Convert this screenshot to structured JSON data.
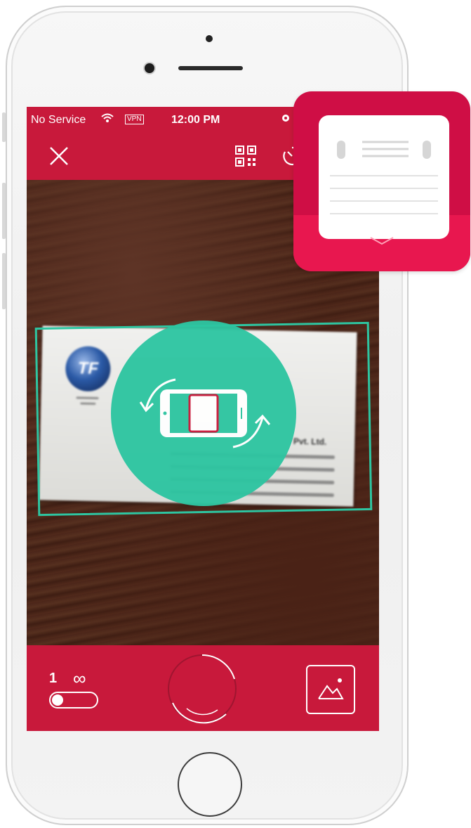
{
  "status_bar": {
    "carrier": "No Service",
    "vpn": "VPN",
    "time": "12:00 PM"
  },
  "toolbar": {
    "close": "close-icon",
    "qr": "qr-code-icon",
    "timer": "timer-icon"
  },
  "card": {
    "logo_text": "TF",
    "company": "Pvt. Ltd."
  },
  "bottom_bar": {
    "batch_single": "1",
    "batch_multi": "∞",
    "shutter": "shutter-icon",
    "gallery": "gallery-icon"
  },
  "colors": {
    "brand_red": "#c8193b",
    "accent_teal": "#2ec5a1",
    "icon_red": "#cf0e45"
  }
}
